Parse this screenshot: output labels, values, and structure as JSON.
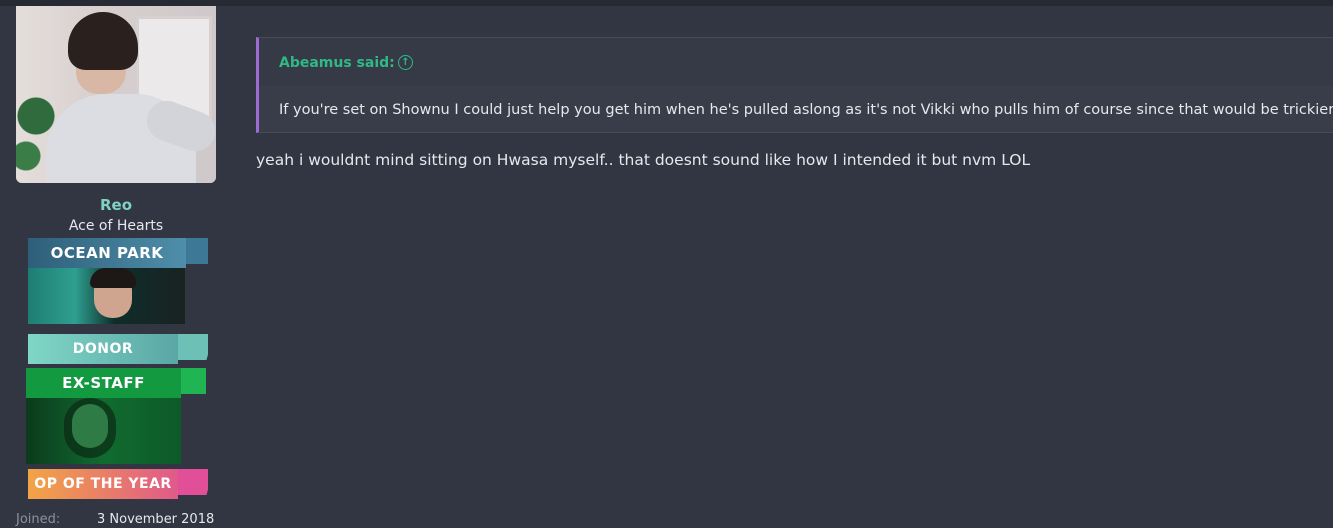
{
  "user": {
    "name": "Reo",
    "title": "Ace of Hearts",
    "banners": [
      {
        "label": "OCEAN PARK"
      },
      {
        "label": "DONOR"
      },
      {
        "label": "EX-STAFF"
      },
      {
        "label": "OP OF THE YEAR"
      }
    ],
    "joined_label": "Joined:",
    "joined_value": "3 November 2018"
  },
  "quote": {
    "author": "Abeamus said:",
    "jump_icon": "arrow-up-circle-icon",
    "text": "If you're set on Shownu I could just help you get him when he's pulled aslong as it's not Vikki who pulls him of course since that would be trickier"
  },
  "message": {
    "text": "yeah i wouldnt mind sitting on Hwasa myself.. that doesnt sound like how I intended it but nvm LOL"
  },
  "colors": {
    "background": "#313642",
    "username": "#7fd1c0",
    "quote_author": "#2fb985",
    "quote_border": "#9d6bd6"
  }
}
